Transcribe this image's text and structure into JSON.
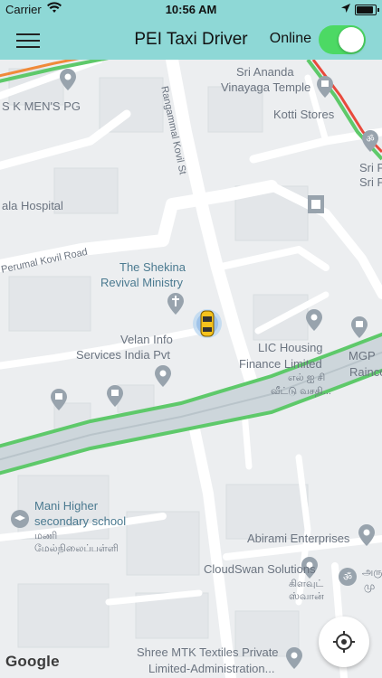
{
  "status_bar": {
    "carrier": "Carrier",
    "time": "10:56 AM"
  },
  "nav": {
    "title": "PEI Taxi Driver",
    "online_label": "Online",
    "online": true
  },
  "colors": {
    "header": "#8ed8d6",
    "toggle_on": "#4cd964",
    "route_green": "#5ec96a"
  },
  "map": {
    "labels": {
      "sk_mens_pg": "S K MEN'S PG",
      "hospital": "ala Hospital",
      "perumal_road": "Perumal Kovil Road",
      "rangammal": "Rangammal Kovil St",
      "temple_line1": "Sri Ananda",
      "temple_line2": "Vinayaga Temple",
      "kotti": "Kotti Stores",
      "sri_p1": "Sri P",
      "sri_p2": "Sri P",
      "shekina_line1": "The Shekina",
      "shekina_line2": "Revival Ministry",
      "velan_line1": "Velan Info",
      "velan_line2": "Services India Pvt",
      "lic_line1": "LIC Housing",
      "lic_line2": "Finance Limited",
      "lic_tamil": "எல் ஐ சி",
      "lic_tamil2": "வீட்டு வசதி...",
      "mgp": "MGP",
      "rainco": "Rainco",
      "mani_line1": "Mani Higher",
      "mani_line2": "secondary school",
      "mani_tamil": "மணி",
      "mani_tamil2": "மேல்நிலைப்பள்ளி",
      "abirami": "Abirami Enterprises",
      "cloudswan": "CloudSwan Solutions",
      "cloudswan_tamil": "கிளவுட்",
      "cloudswan_tamil2": "ஸ்வான்",
      "aru": "அரு",
      "mu": "மு",
      "shree_line1": "Shree MTK Textiles Private",
      "shree_line2": "Limited-Administration..."
    },
    "attribution": "Google"
  }
}
